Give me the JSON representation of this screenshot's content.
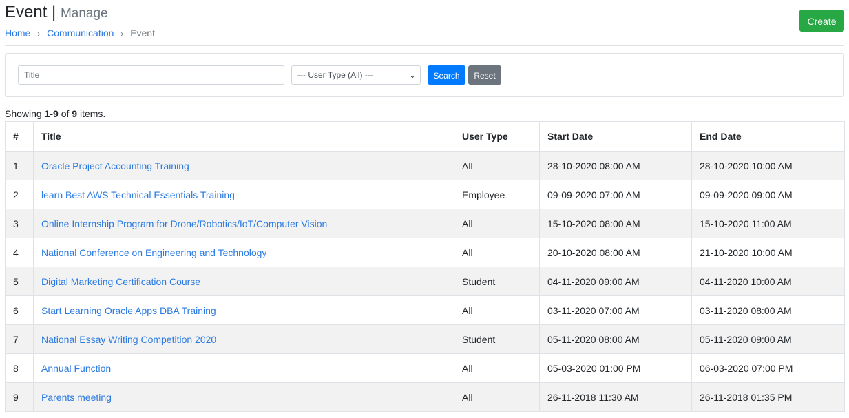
{
  "header": {
    "title": "Event",
    "separator": "|",
    "subtitle": "Manage",
    "create_label": "Create"
  },
  "breadcrumb": [
    {
      "label": "Home",
      "link": true
    },
    {
      "label": "Communication",
      "link": true
    },
    {
      "label": "Event",
      "link": false
    }
  ],
  "breadcrumb_separator": "›",
  "filters": {
    "title_value": "",
    "title_placeholder": "Title",
    "user_type_selected": "--- User Type (All) ---",
    "search_label": "Search",
    "reset_label": "Reset"
  },
  "summary": {
    "prefix": "Showing",
    "range": "1-9",
    "of": "of",
    "total": "9",
    "suffix": "items."
  },
  "table": {
    "columns": [
      "#",
      "Title",
      "User Type",
      "Start Date",
      "End Date"
    ],
    "rows": [
      {
        "num": "1",
        "title": "Oracle Project Accounting Training",
        "user_type": "All",
        "start": "28-10-2020 08:00 AM",
        "end": "28-10-2020 10:00 AM"
      },
      {
        "num": "2",
        "title": "learn Best AWS Technical Essentials Training",
        "user_type": "Employee",
        "start": "09-09-2020 07:00 AM",
        "end": "09-09-2020 09:00 AM"
      },
      {
        "num": "3",
        "title": "Online Internship Program for Drone/Robotics/IoT/Computer Vision",
        "user_type": "All",
        "start": "15-10-2020 08:00 AM",
        "end": "15-10-2020 11:00 AM"
      },
      {
        "num": "4",
        "title": "National Conference on Engineering and Technology",
        "user_type": "All",
        "start": "20-10-2020 08:00 AM",
        "end": "21-10-2020 10:00 AM"
      },
      {
        "num": "5",
        "title": "Digital Marketing Certification Course",
        "user_type": "Student",
        "start": "04-11-2020 09:00 AM",
        "end": "04-11-2020 10:00 AM"
      },
      {
        "num": "6",
        "title": "Start Learning Oracle Apps DBA Training",
        "user_type": "All",
        "start": "03-11-2020 07:00 AM",
        "end": "03-11-2020 08:00 AM"
      },
      {
        "num": "7",
        "title": "National Essay Writing Competition 2020",
        "user_type": "Student",
        "start": "05-11-2020 08:00 AM",
        "end": "05-11-2020 09:00 AM"
      },
      {
        "num": "8",
        "title": "Annual Function",
        "user_type": "All",
        "start": "05-03-2020 01:00 PM",
        "end": "06-03-2020 07:00 PM"
      },
      {
        "num": "9",
        "title": "Parents meeting",
        "user_type": "All",
        "start": "26-11-2018 11:30 AM",
        "end": "26-11-2018 01:35 PM"
      }
    ]
  },
  "colors": {
    "link": "#2a7ae2",
    "create": "#28a745",
    "search": "#007bff",
    "reset": "#6c757d",
    "stripe": "#f2f2f2"
  }
}
